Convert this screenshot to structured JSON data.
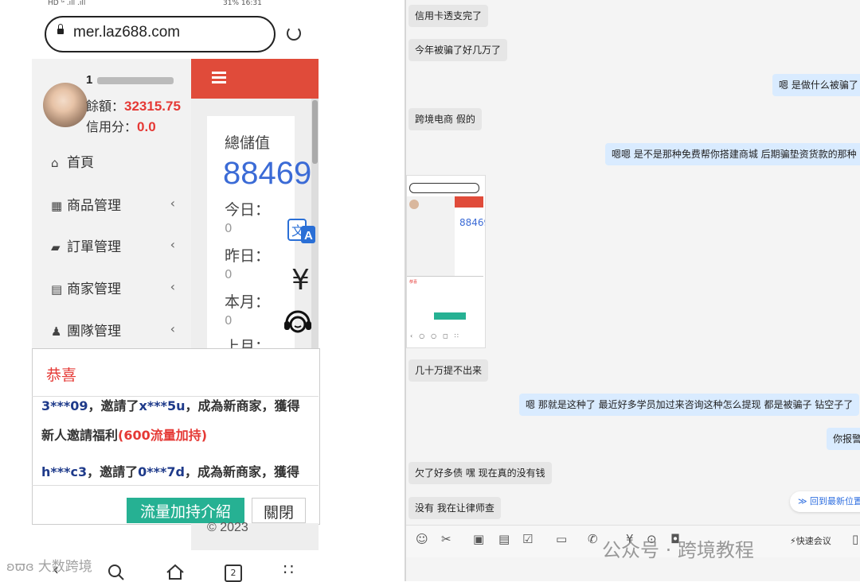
{
  "phone": {
    "status_left": "HD ᴳ .ıll .ıll",
    "status_right": "31%  16:31",
    "url": "mer.laz688.com",
    "user": {
      "phone": "1",
      "balance_label": "餘額：",
      "balance": "32315.75",
      "credit_label": "信用分：",
      "credit": "0.0"
    },
    "nav": [
      {
        "icon": "home-icon",
        "glyph": "⌂",
        "label": "首頁",
        "chevron": ""
      },
      {
        "icon": "grid-icon",
        "glyph": "▦",
        "label": "商品管理",
        "chevron": "‹"
      },
      {
        "icon": "folder-icon",
        "glyph": "▰",
        "label": "訂單管理",
        "chevron": "‹"
      },
      {
        "icon": "id-card-icon",
        "glyph": "▤",
        "label": "商家管理",
        "chevron": "‹"
      },
      {
        "icon": "team-icon",
        "glyph": "♟",
        "label": "團隊管理",
        "chevron": "‹"
      }
    ],
    "card": {
      "total_label": "總儲值",
      "total_value": "88469",
      "today_label": "今日：",
      "today_value": "0",
      "yesterday_label": "昨日：",
      "yesterday_value": "0",
      "month_label": "本月：",
      "month_value": "0",
      "lastmonth_label": "上月："
    },
    "modal": {
      "title": "恭喜",
      "msg1_user": "3***09",
      "msg1_mid": "，邀請了",
      "msg1_invitee": "x***5u",
      "msg1_tail": "，成為新商家，獲得",
      "msg1_line2": "新人邀請福利",
      "msg1_bonus": "(600流量加持)",
      "msg2_user": "h***c3",
      "msg2_mid": "，邀請了",
      "msg2_invitee": "0***7d",
      "msg2_tail": "，成為新商家，獲得",
      "btn_intro": "流量加持介紹",
      "btn_close": "關閉"
    },
    "copyright": "© 2023",
    "watermark": "大数跨境",
    "tabs_count": "2"
  },
  "chat": {
    "messages": [
      {
        "side": "in",
        "text": "信用卡透支完了"
      },
      {
        "side": "in",
        "text": "今年被骗了好几万了"
      },
      {
        "side": "out",
        "text": "嗯  是做什么被骗了"
      },
      {
        "side": "in",
        "text": "跨境电商   假的"
      },
      {
        "side": "out",
        "text": "嗯嗯   是不是那种免费帮你搭建商城  后期骗垫资货款的那种"
      },
      {
        "side": "in",
        "text": "几十万提不出来"
      },
      {
        "side": "out",
        "text": "嗯  那就是这种了  最近好多学员加过来咨询这种怎么提现  都是被骗子 钻空子了"
      },
      {
        "side": "out",
        "text": "你报警"
      },
      {
        "side": "in",
        "text": "欠了好多债  嘿  现在真的没有钱"
      },
      {
        "side": "in",
        "text": "没有  我在让律师查"
      }
    ],
    "back_to_latest": "回到最新位置",
    "quick_meeting": "快速会议",
    "watermark": "公众号 · 跨境教程"
  }
}
